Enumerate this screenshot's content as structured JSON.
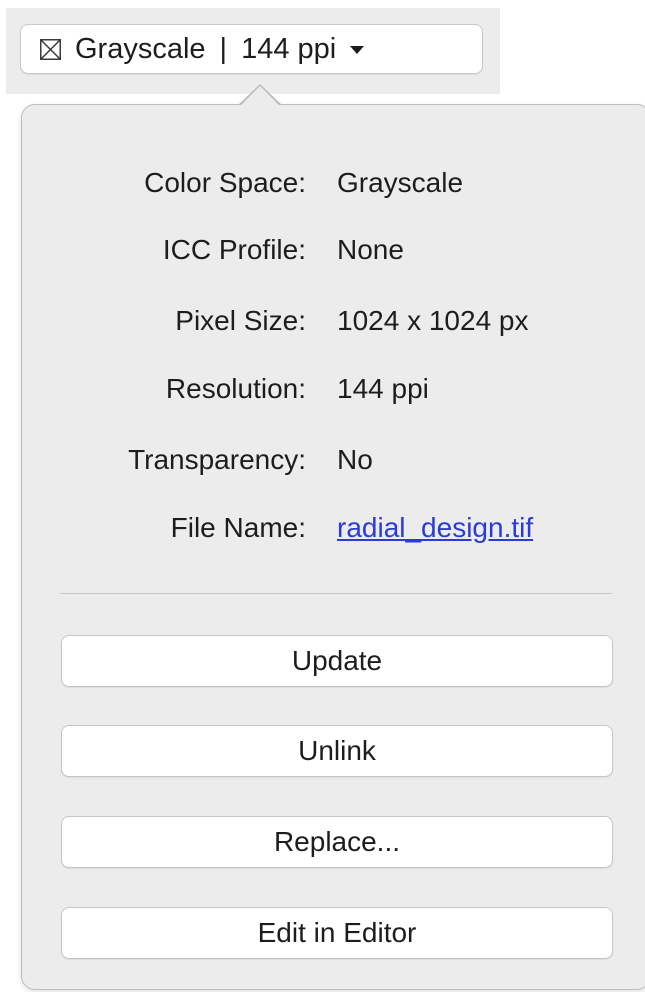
{
  "dropdown": {
    "icon": "image-placeholder-icon",
    "color_mode": "Grayscale",
    "separator": "|",
    "resolution": "144 ppi"
  },
  "info": {
    "rows": [
      {
        "label": "Color Space:",
        "value": "Grayscale"
      },
      {
        "label": "ICC Profile:",
        "value": "None"
      },
      {
        "label": "Pixel Size:",
        "value": "1024 x 1024 px"
      },
      {
        "label": "Resolution:",
        "value": "144 ppi"
      },
      {
        "label": "Transparency:",
        "value": "No"
      },
      {
        "label": "File Name:",
        "value": "radial_design.tif"
      }
    ]
  },
  "actions": {
    "update_label": "Update",
    "unlink_label": "Unlink",
    "replace_label": "Replace...",
    "edit_label": "Edit in Editor"
  },
  "colors": {
    "panel_background": "#ececec",
    "link": "#2a3bd8",
    "button_background": "#ffffff"
  }
}
